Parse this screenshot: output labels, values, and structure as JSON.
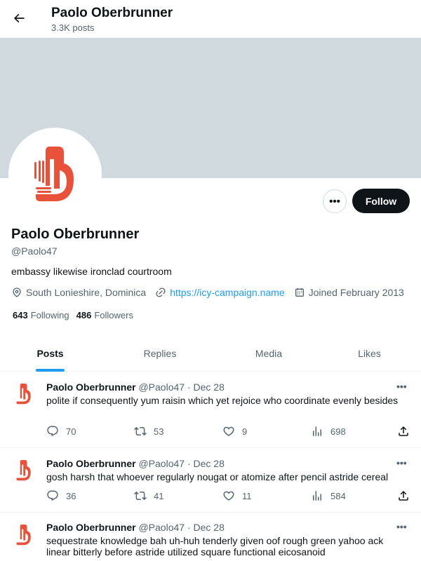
{
  "header": {
    "name": "Paolo Oberbrunner",
    "post_count": "3.3K posts"
  },
  "profile": {
    "name": "Paolo Oberbrunner",
    "handle": "@Paolo47",
    "bio": "embassy likewise ironclad courtroom",
    "location": "South Lonieshire, Dominica",
    "website": "https://icy-campaign.name",
    "joined": "Joined February 2013",
    "following_count": "643",
    "following_label": "Following",
    "followers_count": "486",
    "followers_label": "Followers"
  },
  "actions": {
    "more": "•••",
    "follow": "Follow"
  },
  "tabs": [
    "Posts",
    "Replies",
    "Media",
    "Likes"
  ],
  "active_tab": "Posts",
  "posts": [
    {
      "author": "Paolo Oberbrunner",
      "handle": "@Paolo47",
      "date": "Dec 28",
      "text": "polite if consequently yum raisin which yet rejoice who coordinate evenly besides",
      "replies": "70",
      "reposts": "53",
      "likes": "9",
      "views": "698",
      "more": "•••"
    },
    {
      "author": "Paolo Oberbrunner",
      "handle": "@Paolo47",
      "date": "Dec 28",
      "text": "gosh harsh that whoever regularly nougat or atomize after pencil astride cereal",
      "replies": "36",
      "reposts": "41",
      "likes": "11",
      "views": "584",
      "more": "•••"
    },
    {
      "author": "Paolo Oberbrunner",
      "handle": "@Paolo47",
      "date": "Dec 28",
      "text": "sequestrate knowledge bah uh-huh tenderly given oof rough green yahoo ack linear bitterly before astride utilized square functional eicosanoid",
      "replies": "",
      "reposts": "",
      "likes": "",
      "views": "",
      "more": "•••"
    }
  ],
  "colors": {
    "accent": "#1d9bf0",
    "logo": "#e8523a",
    "banner": "#cfd9de",
    "text": "#0f1419",
    "muted": "#536471"
  }
}
